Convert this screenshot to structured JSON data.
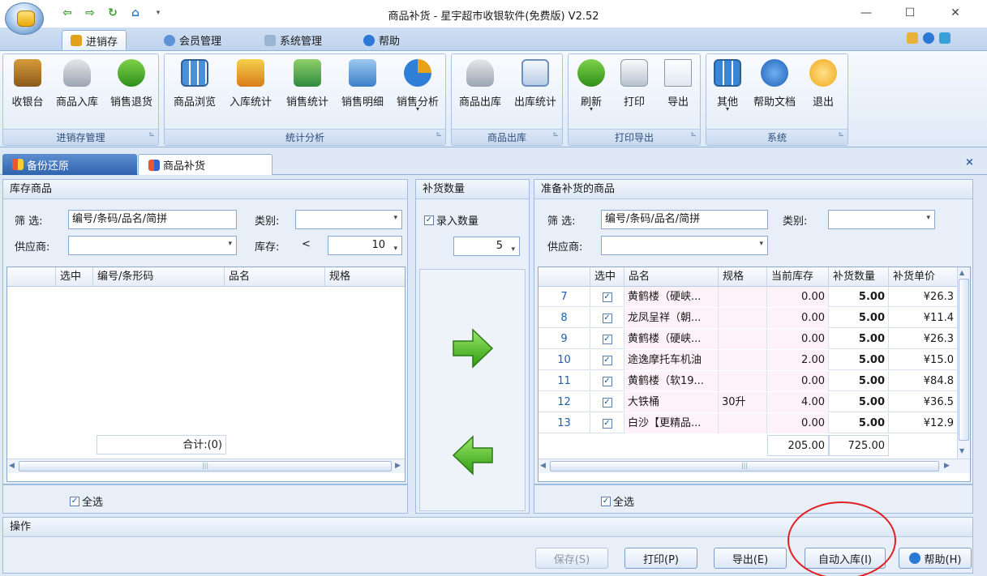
{
  "app": {
    "window_title": "商品补货 - 星宇超市收银软件(免费版) V2.52"
  },
  "colors": {
    "accent": "#1e5fb4",
    "highlight_circle": "#e02020",
    "arrow_green": "#44b012"
  },
  "menu_tabs": [
    {
      "label": "进销存",
      "active": true
    },
    {
      "label": "会员管理"
    },
    {
      "label": "系统管理"
    },
    {
      "label": "帮助"
    }
  ],
  "ribbon": {
    "groups": [
      {
        "label": "进销存管理",
        "buttons": [
          "收银台",
          "商品入库",
          "销售退货"
        ]
      },
      {
        "label": "统计分析",
        "buttons": [
          "商品浏览",
          "入库统计",
          "销售统计",
          "销售明细",
          "销售分析"
        ]
      },
      {
        "label": "商品出库",
        "buttons": [
          "商品出库",
          "出库统计"
        ]
      },
      {
        "label": "打印导出",
        "buttons": [
          "刷新",
          "打印",
          "导出"
        ]
      },
      {
        "label": "系统",
        "buttons": [
          "其他",
          "帮助文档",
          "退出"
        ]
      }
    ]
  },
  "doc_tabs": [
    {
      "label": "备份还原"
    },
    {
      "label": "商品补货",
      "active": true
    }
  ],
  "stock_panel": {
    "title": "库存商品",
    "filter_label": "筛  选:",
    "filter_value": "编号/条码/品名/简拼",
    "category_label": "类别:",
    "category_value": "",
    "supplier_label": "供应商:",
    "supplier_value": "",
    "stock_label": "库存:",
    "stock_op": "<",
    "stock_value": "10",
    "columns": [
      "",
      "选中",
      "编号/条形码",
      "品名",
      "规格"
    ],
    "total_label": "合计:(0)",
    "select_all": "全选"
  },
  "middle_panel": {
    "title": "补货数量",
    "enter_qty_label": "录入数量",
    "qty_value": "5"
  },
  "restock_panel": {
    "title": "准备补货的商品",
    "filter_label": "筛  选:",
    "filter_value": "编号/条码/品名/简拼",
    "category_label": "类别:",
    "category_value": "",
    "supplier_label": "供应商:",
    "supplier_value": "",
    "columns": [
      "",
      "选中",
      "品名",
      "规格",
      "当前库存",
      "补货数量",
      "补货单价"
    ],
    "rows": [
      {
        "no": "7",
        "name": "黄鹤楼（硬峡...",
        "spec": "",
        "stock": "0.00",
        "qty": "5.00",
        "price": "¥26.3"
      },
      {
        "no": "8",
        "name": "龙凤呈祥（朝...",
        "spec": "",
        "stock": "0.00",
        "qty": "5.00",
        "price": "¥11.4"
      },
      {
        "no": "9",
        "name": "黄鹤楼（硬峡...",
        "spec": "",
        "stock": "0.00",
        "qty": "5.00",
        "price": "¥26.3"
      },
      {
        "no": "10",
        "name": "途逸摩托车机油",
        "spec": "",
        "stock": "2.00",
        "qty": "5.00",
        "price": "¥15.0"
      },
      {
        "no": "11",
        "name": "黄鹤楼（软19...",
        "spec": "",
        "stock": "0.00",
        "qty": "5.00",
        "price": "¥84.8"
      },
      {
        "no": "12",
        "name": "大铁桶",
        "spec": "30升",
        "stock": "4.00",
        "qty": "5.00",
        "price": "¥36.5"
      },
      {
        "no": "13",
        "name": "白沙【更精品...",
        "spec": "",
        "stock": "0.00",
        "qty": "5.00",
        "price": "¥12.9"
      }
    ],
    "total_stock": "205.00",
    "total_qty": "725.00",
    "select_all": "全选"
  },
  "operations": {
    "title": "操作",
    "save": "保存(S)",
    "print": "打印(P)",
    "export": "导出(E)",
    "auto_stock_in": "自动入库(I)",
    "help": "帮助(H)"
  }
}
